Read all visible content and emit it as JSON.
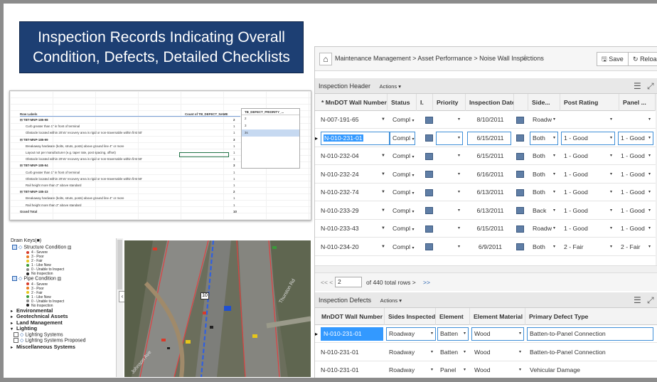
{
  "slide_title_line1": "Inspection Records Indicating Overall",
  "slide_title_line2": "Condition, Defects, Detailed Checklists",
  "spreadsheet": {
    "col_row_labels": "Row Labels",
    "col_count": "Count of TB_DEFECT_NAME",
    "rows": [
      {
        "label": "⊟ TBT-MNP-185-98",
        "count": "2",
        "indent": false
      },
      {
        "label": "Curb greater than 1\" in front of terminal",
        "count": "1",
        "indent": true
      },
      {
        "label": "Obstacle located within 20'x5' recovery area is rigid or non-traversable within first 50'",
        "count": "1",
        "indent": true
      },
      {
        "label": "⊟ TBT-MNP-185-99",
        "count": "3",
        "indent": false
      },
      {
        "label": "Breakaway hardware (bolts, struts, posts) above ground line 4\" or more",
        "count": "1",
        "indent": true
      },
      {
        "label": "Layout not per manufacturer (e.g. taper rate, post spacing, offset)",
        "count": "1",
        "indent": true
      },
      {
        "label": "Obstacle located within 20'x5' recovery area is rigid or non-traversable within first 50'",
        "count": "1",
        "indent": true
      },
      {
        "label": "⊟ TBT-MNP-185-94",
        "count": "3",
        "indent": false
      },
      {
        "label": "Curb greater than 1\" in front of terminal",
        "count": "1",
        "indent": true
      },
      {
        "label": "Obstacle located within 20'x5' recovery area is rigid or non-traversable within first 50'",
        "count": "1",
        "indent": true
      },
      {
        "label": "Rail height more than 2\" above standard",
        "count": "1",
        "indent": true
      },
      {
        "label": "⊟ TBT-MNP-185-33",
        "count": "2",
        "indent": false
      },
      {
        "label": "Breakaway hardware (bolts, struts, posts) above ground line 4\" or more",
        "count": "1",
        "indent": true
      },
      {
        "label": "Rail height more than 2\" above standard",
        "count": "1",
        "indent": true
      },
      {
        "label": "Grand Total",
        "count": "10",
        "indent": false
      }
    ],
    "filter_title": "TB_DEFECT_PRIORITY_...",
    "filter_items": [
      "2",
      "3",
      "3s"
    ]
  },
  "legend": {
    "items": [
      {
        "kind": "head",
        "text": "Drain Keys(■)"
      },
      {
        "kind": "layer",
        "text": "Structure Condition"
      },
      {
        "kind": "sub",
        "text": "4 - Severe",
        "color": "#d83a2a"
      },
      {
        "kind": "sub",
        "text": "3 - Poor",
        "color": "#e87a1e"
      },
      {
        "kind": "sub",
        "text": "2 - Fair",
        "color": "#e6c61a"
      },
      {
        "kind": "sub",
        "text": "1 - Like New",
        "color": "#3a9a3a"
      },
      {
        "kind": "sub",
        "text": "0 - Unable to Inspect",
        "color": "#888888"
      },
      {
        "kind": "sub",
        "text": "No Inspection",
        "color": "#222222"
      },
      {
        "kind": "layer",
        "text": "Pipe Condition"
      },
      {
        "kind": "sub",
        "text": "4 - Severe",
        "color": "#d83a2a"
      },
      {
        "kind": "sub",
        "text": "3 - Poor",
        "color": "#e87a1e"
      },
      {
        "kind": "sub",
        "text": "2 - Fair",
        "color": "#e6c61a"
      },
      {
        "kind": "sub",
        "text": "1 - Like New",
        "color": "#3a9a3a"
      },
      {
        "kind": "sub",
        "text": "0 - Unable to Inspect",
        "color": "#888888"
      },
      {
        "kind": "sub",
        "text": "No Inspection",
        "color": "#222222"
      },
      {
        "kind": "group",
        "text": "Environmental",
        "open": false
      },
      {
        "kind": "group",
        "text": "Geotechnical Assets",
        "open": false
      },
      {
        "kind": "group",
        "text": "Land Management",
        "open": false
      },
      {
        "kind": "group",
        "text": "Lighting",
        "open": true
      },
      {
        "kind": "check",
        "text": "Lighting Systems"
      },
      {
        "kind": "check",
        "text": "Lighting Systems Proposed"
      },
      {
        "kind": "group",
        "text": "Miscellaneous Systems",
        "open": false
      }
    ]
  },
  "map": {
    "route_label": "10",
    "road_label_1": "Thurston Rd",
    "road_label_2": "Johnson Ave"
  },
  "app": {
    "breadcrumb": "Maintenance Management > Asset Performance > Noise Wall Inspections",
    "save_label": "Save",
    "reload_label": "Reload",
    "header_section": "Inspection Header",
    "actions_label": "Actions ▾",
    "header_columns": [
      "* MnDOT Wall Number",
      "Status",
      "I.",
      "Priority",
      "Inspection Date",
      "",
      "Side...",
      "Post Rating",
      "Panel ..."
    ],
    "header_rows": [
      {
        "wall": "N-007-191-65",
        "status": "Compl",
        "date": "8/10/2011",
        "side": "Roadw",
        "post": "",
        "panel": ""
      },
      {
        "wall": "N-010-231-01",
        "status": "Compl",
        "date": "6/15/2011",
        "side": "Both",
        "post": "1 - Good",
        "panel": "1 - Good"
      },
      {
        "wall": "N-010-232-04",
        "status": "Compl",
        "date": "6/15/2011",
        "side": "Both",
        "post": "1 - Good",
        "panel": "1 - Good"
      },
      {
        "wall": "N-010-232-24",
        "status": "Compl",
        "date": "6/16/2011",
        "side": "Both",
        "post": "1 - Good",
        "panel": "1 - Good"
      },
      {
        "wall": "N-010-232-74",
        "status": "Compl",
        "date": "6/13/2011",
        "side": "Both",
        "post": "1 - Good",
        "panel": "1 - Good"
      },
      {
        "wall": "N-010-233-29",
        "status": "Compl",
        "date": "6/13/2011",
        "side": "Back",
        "post": "1 - Good",
        "panel": "1 - Good"
      },
      {
        "wall": "N-010-233-43",
        "status": "Compl",
        "date": "6/15/2011",
        "side": "Roadw",
        "post": "1 - Good",
        "panel": "1 - Good"
      },
      {
        "wall": "N-010-234-20",
        "status": "Compl",
        "date": "6/9/2011",
        "side": "Both",
        "post": "2 - Fair",
        "panel": "2 - Fair"
      }
    ],
    "pager_prev": "<< <",
    "pager_page": "2",
    "pager_total": "of 440 total rows >",
    "pager_next": ">>",
    "defects_section": "Inspection Defects",
    "defects_columns": [
      "MnDOT Wall Number",
      "Sides Inspected",
      "Element",
      "Element Material",
      "Primary Defect Type"
    ],
    "defects_rows": [
      {
        "wall": "N-010-231-01",
        "sides": "Roadway",
        "element": "Batten",
        "material": "Wood",
        "defect": "Batten-to-Panel Connection"
      },
      {
        "wall": "N-010-231-01",
        "sides": "Roadway",
        "element": "Batten",
        "material": "Wood",
        "defect": "Batten-to-Panel Connection"
      },
      {
        "wall": "N-010-231-01",
        "sides": "Roadway",
        "element": "Panel",
        "material": "Wood",
        "defect": "Vehicular Damage"
      }
    ]
  }
}
